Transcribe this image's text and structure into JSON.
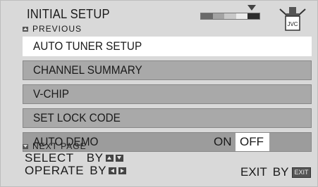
{
  "header": {
    "title": "INITIAL SETUP",
    "previous_label": "PREVIOUS",
    "next_label": "NEXT PAGE",
    "brand_logo_text": "JVC",
    "page_progress_fraction": 0.8
  },
  "menu": {
    "items": [
      {
        "label": "AUTO TUNER SETUP",
        "selected": true
      },
      {
        "label": "CHANNEL SUMMARY",
        "selected": false
      },
      {
        "label": "V-CHIP",
        "selected": false
      },
      {
        "label": "SET LOCK CODE",
        "selected": false
      },
      {
        "label": "AUTO DEMO",
        "selected": false
      }
    ],
    "auto_demo": {
      "on_label": "ON",
      "off_label": "OFF",
      "current": "OFF"
    }
  },
  "footer": {
    "select_label": "SELECT",
    "operate_label": "OPERATE",
    "by_label": "BY",
    "exit_label": "EXIT",
    "exit_key": "EXIT"
  },
  "colors": {
    "background": "#d9d9d9",
    "item_bg": "#a9a9a9",
    "selected_bg": "#ffffff"
  }
}
